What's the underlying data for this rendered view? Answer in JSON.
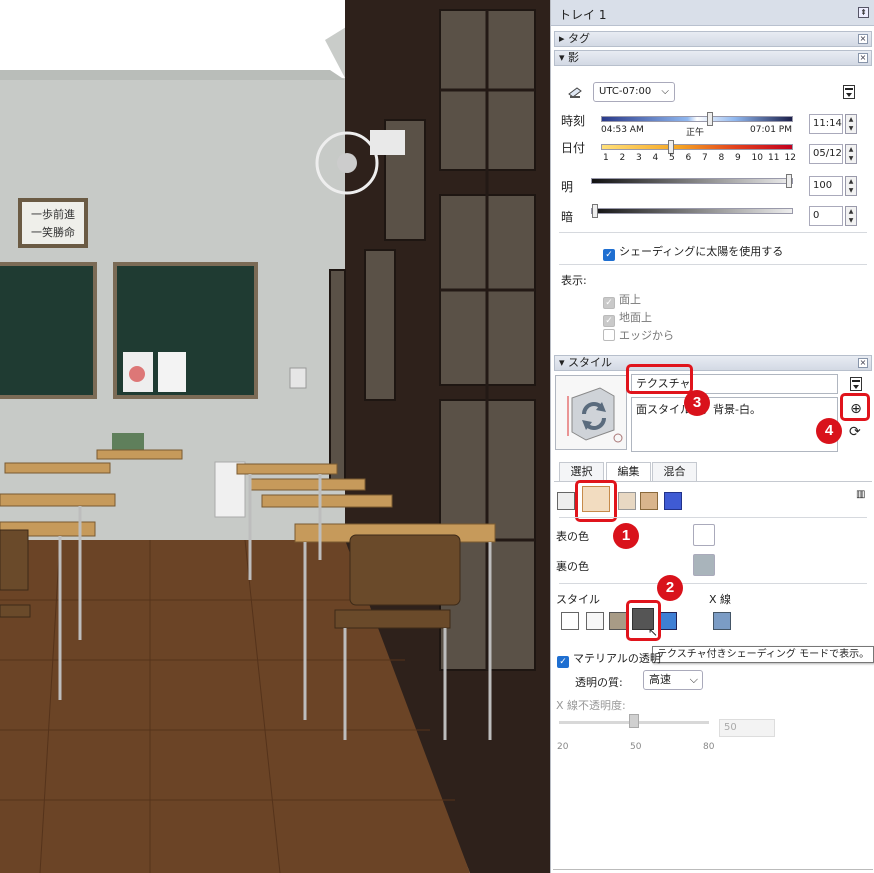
{
  "tray": {
    "title": "トレイ 1",
    "pin_glyph": "⇞"
  },
  "sections": {
    "tags": {
      "arrow": "▸",
      "label": "タグ",
      "close": "×"
    },
    "shadows": {
      "arrow": "▾",
      "label": "影",
      "close": "×"
    },
    "styles": {
      "arrow": "▾",
      "label": "スタイル",
      "close": "×"
    }
  },
  "shadows": {
    "timezone": "UTC-07:00",
    "time_label": "時刻",
    "time_left": "04:53 AM",
    "time_mid": "正午",
    "time_right": "07:01 PM",
    "time_value": "11:14",
    "date_label": "日付",
    "month_ticks": [
      "1",
      "2",
      "3",
      "4",
      "5",
      "6",
      "7",
      "8",
      "9",
      "10",
      "11",
      "12"
    ],
    "date_value": "05/12",
    "light_label": "明",
    "light_value": "100",
    "dark_label": "暗",
    "dark_value": "0",
    "use_sun_label": "シェーディングに太陽を使用する",
    "display_label": "表示:",
    "on_faces": "面上",
    "on_ground": "地面上",
    "from_edges": "エッジから",
    "time_fraction": 0.57,
    "month_fraction": 0.36,
    "light_fraction": 1.0,
    "dark_fraction": 0.0
  },
  "styles": {
    "name_value": "テクスチャ",
    "description": "面スタイル…。背景-白。",
    "tabs": [
      "選択",
      "編集",
      "混合"
    ],
    "front_color_label": "表の色",
    "back_color_label": "裏の色",
    "front_color": "#ffffff",
    "back_color": "#a9b4bb",
    "style_label": "スタイル",
    "xray_label": "X 線",
    "tooltip": "テクスチャ付きシェーディング モードで表示。",
    "material_transparency_label": "マテリアルの透明",
    "transparency_quality_label": "透明の質:",
    "transparency_quality_value": "高速",
    "xray_opacity_label": "X 線不透明度:",
    "xray_opacity_value": "50",
    "scale_ticks": [
      "20",
      "50",
      "80"
    ],
    "xray_fraction": 0.5
  },
  "callouts": [
    "1",
    "2",
    "3",
    "4"
  ],
  "colors": {
    "accent": "#1f6fd1",
    "callout_red": "#d9121b"
  }
}
